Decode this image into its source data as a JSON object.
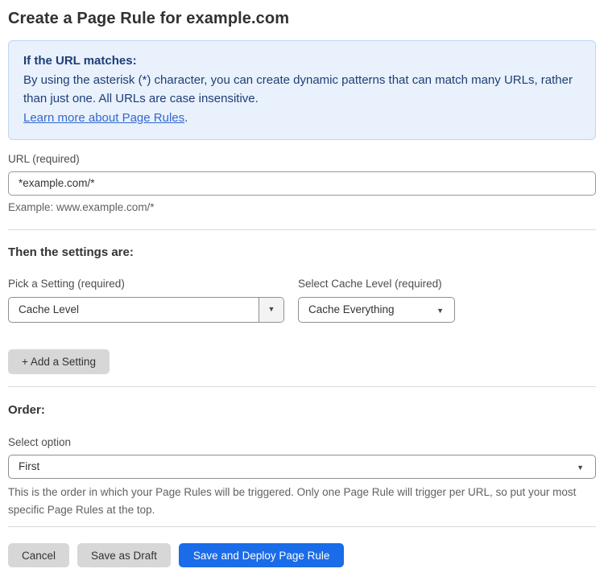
{
  "page": {
    "title": "Create a Page Rule for example.com"
  },
  "info_box": {
    "heading": "If the URL matches:",
    "body": "By using the asterisk (*) character, you can create dynamic patterns that can match many URLs, rather than just one. All URLs are case insensitive.",
    "link_label": "Learn more about Page Rules",
    "link_suffix": "."
  },
  "url_field": {
    "label": "URL (required)",
    "value": "*example.com/*",
    "hint": "Example: www.example.com/*"
  },
  "settings_section": {
    "heading": "Then the settings are:",
    "setting_picker": {
      "label": "Pick a Setting (required)",
      "value": "Cache Level"
    },
    "cache_level_picker": {
      "label": "Select Cache Level (required)",
      "value": "Cache Everything"
    },
    "add_setting_label": "+ Add a Setting"
  },
  "order_section": {
    "heading": "Order:",
    "select_label": "Select option",
    "value": "First",
    "help_text": "This is the order in which your Page Rules will be triggered. Only one Page Rule will trigger per URL, so put your most specific Page Rules at the top."
  },
  "actions": {
    "cancel_label": "Cancel",
    "save_draft_label": "Save as Draft",
    "save_deploy_label": "Save and Deploy Page Rule"
  },
  "icons": {
    "dropdown_caret": "▼"
  },
  "colors": {
    "info_box_bg": "#e8f1fc",
    "info_box_border": "#bdd7f2",
    "info_text": "#1f3d77",
    "link_blue": "#3468d0",
    "primary_button_bg": "#1a6ce8",
    "gray_button_bg": "#d7d7d7",
    "divider": "#d9d9d9"
  }
}
